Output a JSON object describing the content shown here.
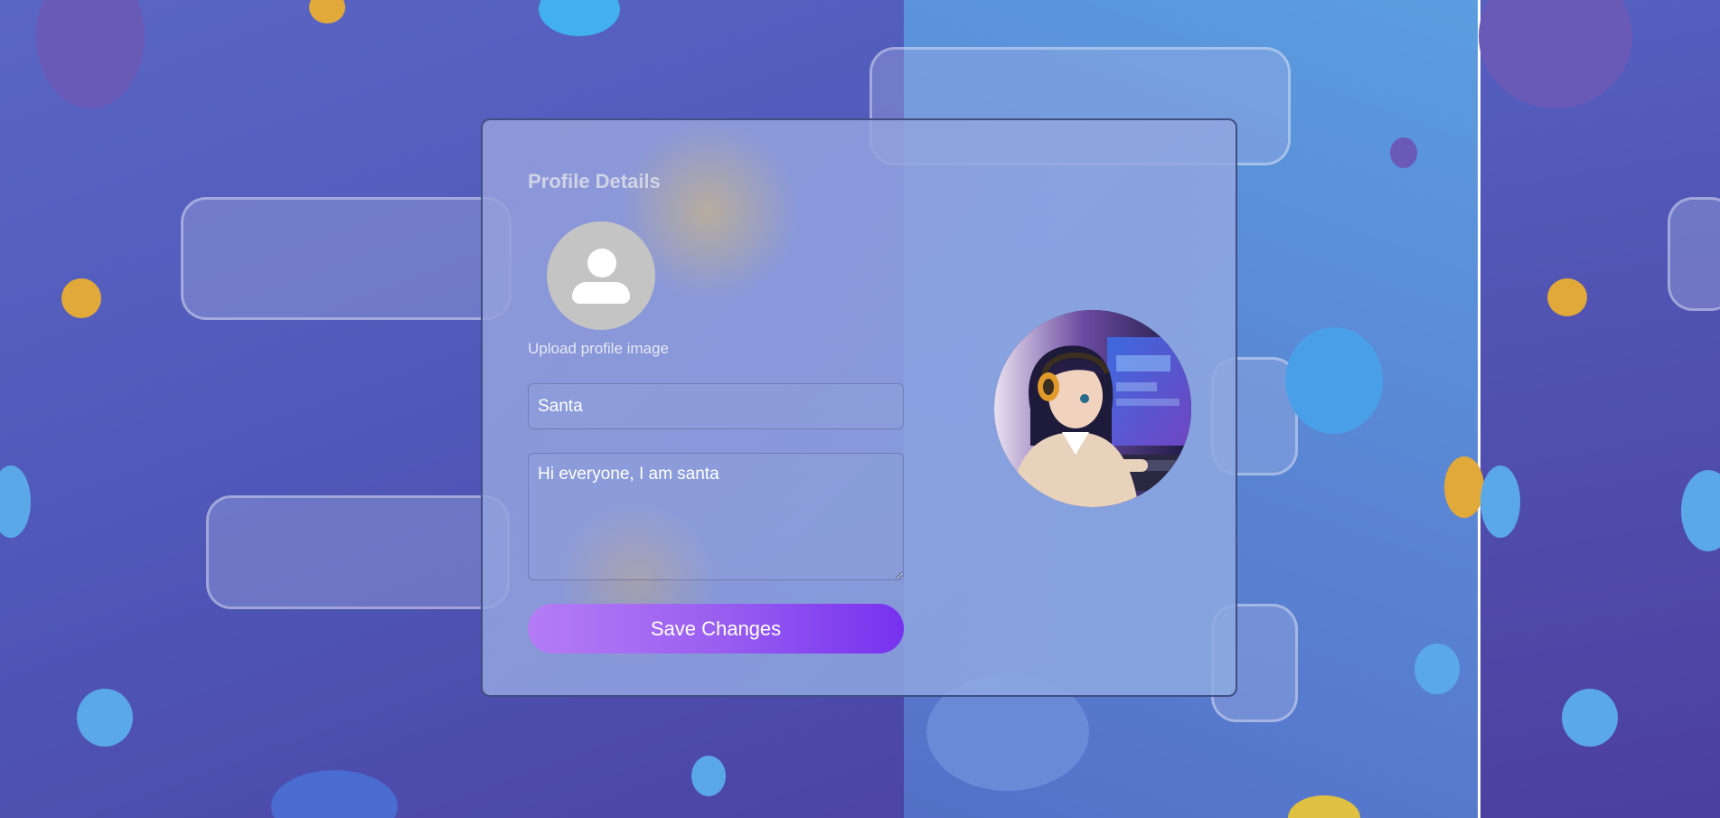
{
  "profile": {
    "title": "Profile Details",
    "upload_label": "Upload profile image",
    "name_value": "Santa",
    "bio_value": "Hi everyone, I am santa",
    "save_label": "Save Changes"
  },
  "icons": {
    "placeholder_avatar": "user-silhouette-icon",
    "profile_photo": "anime-girl-headphones-image"
  },
  "colors": {
    "button_gradient_start": "#b57cf6",
    "button_gradient_end": "#7631ef",
    "card_border": "#3f4f82",
    "placeholder_gray": "#c4c4c4"
  }
}
